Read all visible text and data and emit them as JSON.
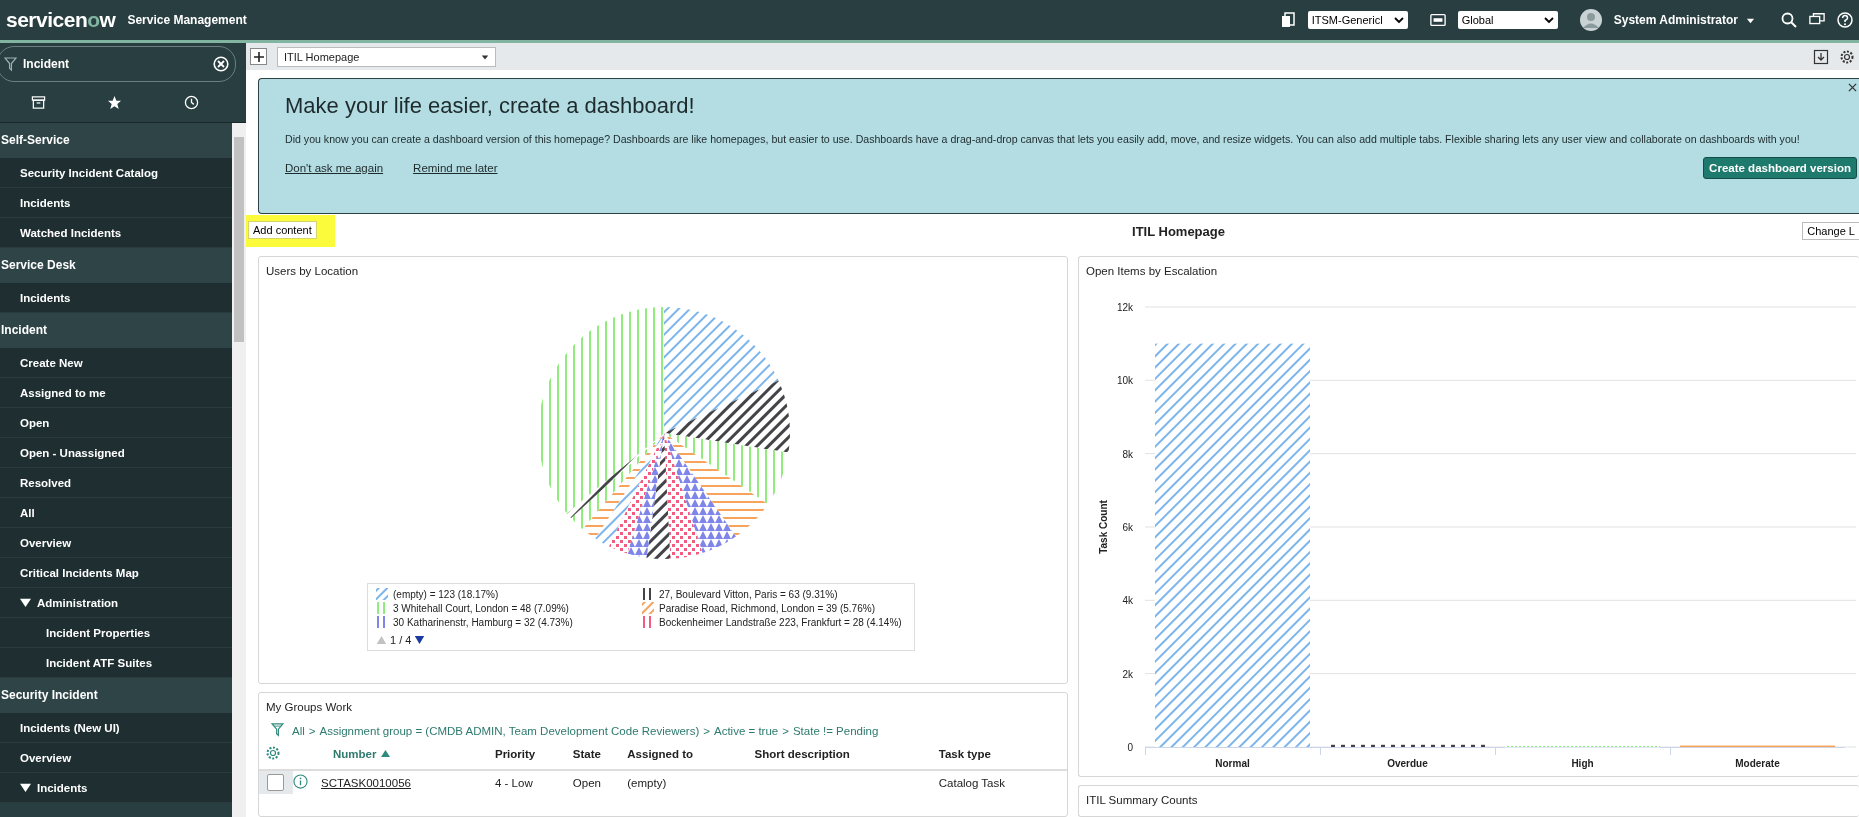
{
  "header": {
    "brand_left": "servicen",
    "brand_o": "o",
    "brand_right": "w",
    "product": "Service Management",
    "selects": [
      {
        "value": "ITSM-Genericl"
      },
      {
        "value": "Global"
      }
    ],
    "user": "System Administrator"
  },
  "sidebar": {
    "filter": "Incident",
    "menu": [
      {
        "kind": "app",
        "label": "Self-Service",
        "children": [
          {
            "label": "Security Incident Catalog"
          },
          {
            "label": "Incidents"
          },
          {
            "label": "Watched Incidents"
          }
        ]
      },
      {
        "kind": "app",
        "label": "Service Desk",
        "children": [
          {
            "label": "Incidents"
          }
        ]
      },
      {
        "kind": "app",
        "label": "Incident",
        "children": [
          {
            "label": "Create New"
          },
          {
            "label": "Assigned to me"
          },
          {
            "label": "Open"
          },
          {
            "label": "Open - Unassigned"
          },
          {
            "label": "Resolved"
          },
          {
            "label": "All"
          },
          {
            "label": "Overview"
          },
          {
            "label": "Critical Incidents Map"
          },
          {
            "label": "Administration",
            "expanded": true,
            "children": [
              {
                "label": "Incident Properties"
              },
              {
                "label": "Incident ATF Suites"
              }
            ]
          }
        ]
      },
      {
        "kind": "app",
        "label": "Security Incident",
        "children": [
          {
            "label": "Incidents (New UI)"
          },
          {
            "label": "Overview"
          },
          {
            "label": "Incidents",
            "expanded": true
          }
        ]
      }
    ]
  },
  "toolbar": {
    "homepage_select": "ITIL Homepage"
  },
  "banner": {
    "title": "Make your life easier, create a dashboard!",
    "body": "Did you know you can create a dashboard version of this homepage? Dashboards are like homepages, but easier to use. Dashboards have a drag-and-drop canvas that lets you easily add, move, and resize widgets. You can also add multiple tabs. Flexible sharing lets any user view and collaborate on dashboards with you!",
    "links": [
      "Don't ask me again",
      "Remind me later"
    ],
    "button": "Create dashboard version"
  },
  "page": {
    "add_content": "Add content",
    "title": "ITIL Homepage",
    "change_layout": "Change L"
  },
  "users_by_location": {
    "title": "Users by Location",
    "legend": [
      {
        "label": "(empty) = 123 (18.17%)",
        "color": "#7cb5ec"
      },
      {
        "label": "27, Boulevard Vitton, Paris = 63 (9.31%)",
        "color": "#434348"
      },
      {
        "label": "3 Whitehall Court, London = 48 (7.09%)",
        "color": "#90ed7d"
      },
      {
        "label": "Paradise Road, Richmond, London = 39 (5.76%)",
        "color": "#f7a35c"
      },
      {
        "label": "30 Katharinenstr, Hamburg = 32 (4.73%)",
        "color": "#8085e9"
      },
      {
        "label": "Bockenheimer Landstraße 223, Frankfurt = 28 (4.14%)",
        "color": "#f15c80"
      }
    ],
    "pager": {
      "text": "1 / 4",
      "prev_disabled": true,
      "next_disabled": false
    }
  },
  "open_items": {
    "chart_data": {
      "type": "bar",
      "title": "Open Items by Escalation",
      "ylabel": "Task Count",
      "categories": [
        "Normal",
        "Overdue",
        "High",
        "Moderate"
      ],
      "series": [
        {
          "values": [
            11000,
            60,
            30,
            40
          ]
        }
      ],
      "ylim": [
        0,
        12000
      ],
      "grid": true,
      "yticks": [
        0,
        {
          "value": 2000,
          "label": "2k"
        },
        {
          "value": 4000,
          "label": "4k"
        },
        {
          "value": 6000,
          "label": "6k"
        },
        {
          "value": 8000,
          "label": "8k"
        },
        {
          "value": 10000,
          "label": "10k"
        },
        {
          "value": 12000,
          "label": "12k"
        }
      ]
    }
  },
  "groups_work": {
    "title": "My Groups Work",
    "filter": [
      "All",
      "Assignment group = (CMDB ADMIN, Team Development Code Reviewers)",
      "Active = true",
      "State != Pending"
    ],
    "filter_separator": ">",
    "columns": [
      {
        "label": "Number",
        "sorted": true
      },
      {
        "label": "Priority",
        "sorted": false
      },
      {
        "label": "State",
        "sorted": false
      },
      {
        "label": "Assigned to",
        "sorted": false
      },
      {
        "label": "Short description",
        "sorted": false
      },
      {
        "label": "Task type",
        "sorted": false
      }
    ],
    "rows": [
      {
        "checked": false,
        "cells": [
          "SCTASK0010056",
          "4 - Low",
          "Open",
          "(empty)",
          "",
          "Catalog Task"
        ]
      }
    ]
  },
  "summary": {
    "title": "ITIL Summary Counts"
  }
}
